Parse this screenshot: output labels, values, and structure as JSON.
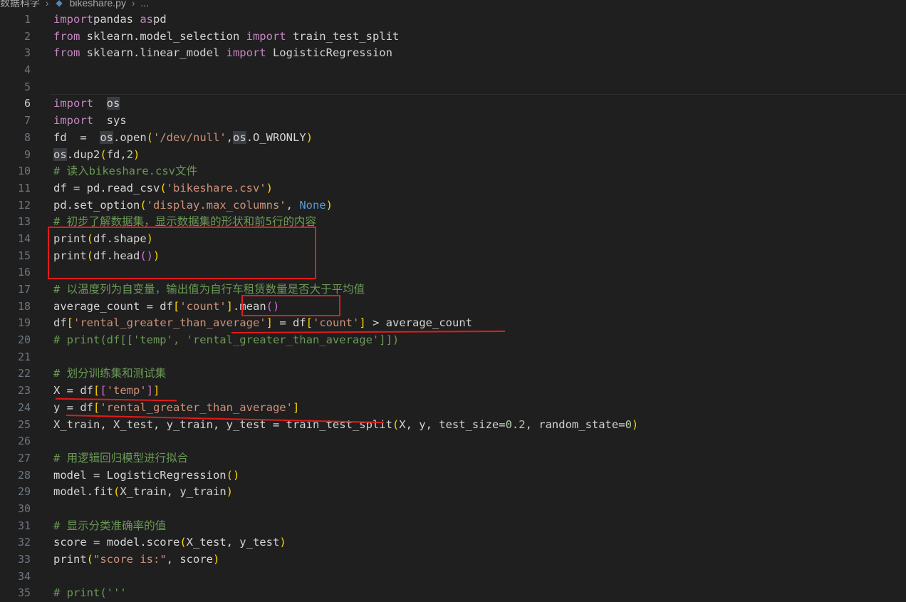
{
  "breadcrumb": {
    "folder": "数据科学",
    "file": "bikeshare.py",
    "more": "..."
  },
  "editor": {
    "active_line": 6,
    "lines": [
      {
        "n": "1",
        "tokens": [
          [
            "kw2",
            "import"
          ],
          [
            "",
            "pandas"
          ],
          [
            "kw2",
            " as"
          ],
          [
            "",
            "pd"
          ]
        ]
      },
      {
        "n": "2",
        "tokens": [
          [
            "kw2",
            "from"
          ],
          [
            "",
            " sklearn.model_selection "
          ],
          [
            "kw2",
            "import"
          ],
          [
            "",
            " train_test_split"
          ]
        ]
      },
      {
        "n": "3",
        "tokens": [
          [
            "kw2",
            "from"
          ],
          [
            "",
            " sklearn.linear_model "
          ],
          [
            "kw2",
            "import"
          ],
          [
            "",
            " LogisticRegression"
          ]
        ]
      },
      {
        "n": "4",
        "tokens": []
      },
      {
        "n": "5",
        "tokens": []
      },
      {
        "n": "6",
        "tokens": [
          [
            "kw2",
            "import"
          ],
          [
            "",
            "  "
          ],
          [
            "hl",
            "os"
          ]
        ]
      },
      {
        "n": "7",
        "tokens": [
          [
            "kw2",
            "import"
          ],
          [
            "",
            "  sys"
          ]
        ]
      },
      {
        "n": "8",
        "tokens": [
          [
            "",
            "fd  =  "
          ],
          [
            "hl",
            "os"
          ],
          [
            "",
            ".open"
          ],
          [
            "br1",
            "("
          ],
          [
            "str",
            "'/dev/null'"
          ],
          [
            "",
            ","
          ],
          [
            "hl",
            "os"
          ],
          [
            "",
            ".O_WRONLY"
          ],
          [
            "br1",
            ")"
          ]
        ]
      },
      {
        "n": "9",
        "tokens": [
          [
            "hl",
            "os"
          ],
          [
            "",
            ".dup2"
          ],
          [
            "br1",
            "("
          ],
          [
            "",
            "fd,"
          ],
          [
            "num",
            "2"
          ],
          [
            "br1",
            ")"
          ]
        ]
      },
      {
        "n": "10",
        "tokens": [
          [
            "cmt",
            "# 读入bikeshare.csv文件"
          ]
        ]
      },
      {
        "n": "11",
        "tokens": [
          [
            "",
            "df = pd.read_csv"
          ],
          [
            "br1",
            "("
          ],
          [
            "str",
            "'bikeshare.csv'"
          ],
          [
            "br1",
            ")"
          ]
        ]
      },
      {
        "n": "12",
        "tokens": [
          [
            "",
            "pd.set_option"
          ],
          [
            "br1",
            "("
          ],
          [
            "str",
            "'display.max_columns'"
          ],
          [
            "",
            ", "
          ],
          [
            "kw",
            "None"
          ],
          [
            "br1",
            ")"
          ]
        ]
      },
      {
        "n": "13",
        "tokens": [
          [
            "cmt",
            "# 初步了解数据集，显示数据集的形状和前5行的内容"
          ]
        ]
      },
      {
        "n": "14",
        "tokens": [
          [
            "",
            "print"
          ],
          [
            "br1",
            "("
          ],
          [
            "",
            "df.shape"
          ],
          [
            "br1",
            ")"
          ]
        ]
      },
      {
        "n": "15",
        "tokens": [
          [
            "",
            "print"
          ],
          [
            "br1",
            "("
          ],
          [
            "",
            "df.head"
          ],
          [
            "br2",
            "()"
          ],
          [
            "br1",
            ")"
          ]
        ]
      },
      {
        "n": "16",
        "tokens": []
      },
      {
        "n": "17",
        "tokens": [
          [
            "cmt",
            "# 以温度列为自变量，输出值为自行车租赁数量是否大于平均值"
          ]
        ]
      },
      {
        "n": "18",
        "tokens": [
          [
            "",
            "average_count = df"
          ],
          [
            "br1",
            "["
          ],
          [
            "str",
            "'count'"
          ],
          [
            "br1",
            "]"
          ],
          [
            "",
            "."
          ],
          [
            "",
            "mean"
          ],
          [
            "br2",
            "()"
          ]
        ]
      },
      {
        "n": "19",
        "tokens": [
          [
            "",
            "df"
          ],
          [
            "br1",
            "["
          ],
          [
            "str",
            "'rental_greater_than_average'"
          ],
          [
            "br1",
            "]"
          ],
          [
            "",
            " = df"
          ],
          [
            "br1",
            "["
          ],
          [
            "str",
            "'count'"
          ],
          [
            "br1",
            "]"
          ],
          [
            "",
            " > average_count"
          ]
        ]
      },
      {
        "n": "20",
        "tokens": [
          [
            "cmt",
            "# print(df[['temp', 'rental_greater_than_average']])"
          ]
        ]
      },
      {
        "n": "21",
        "tokens": []
      },
      {
        "n": "22",
        "tokens": [
          [
            "cmt",
            "# 划分训练集和测试集"
          ]
        ]
      },
      {
        "n": "23",
        "tokens": [
          [
            "",
            "X = df"
          ],
          [
            "br1",
            "["
          ],
          [
            "br2",
            "["
          ],
          [
            "str",
            "'temp'"
          ],
          [
            "br2",
            "]"
          ],
          [
            "br1",
            "]"
          ]
        ]
      },
      {
        "n": "24",
        "tokens": [
          [
            "",
            "y = df"
          ],
          [
            "br1",
            "["
          ],
          [
            "str",
            "'rental_greater_than_average'"
          ],
          [
            "br1",
            "]"
          ]
        ]
      },
      {
        "n": "25",
        "tokens": [
          [
            "",
            "X_train, X_test, y_train, y_test = train_test_split"
          ],
          [
            "br1",
            "("
          ],
          [
            "",
            "X, y, test_size="
          ],
          [
            "num",
            "0.2"
          ],
          [
            "",
            ", random_state="
          ],
          [
            "num",
            "0"
          ],
          [
            "br1",
            ")"
          ]
        ]
      },
      {
        "n": "26",
        "tokens": []
      },
      {
        "n": "27",
        "tokens": [
          [
            "cmt",
            "# 用逻辑回归模型进行拟合"
          ]
        ]
      },
      {
        "n": "28",
        "tokens": [
          [
            "",
            "model = LogisticRegression"
          ],
          [
            "br1",
            "()"
          ]
        ]
      },
      {
        "n": "29",
        "tokens": [
          [
            "",
            "model.fit"
          ],
          [
            "br1",
            "("
          ],
          [
            "",
            "X_train, y_train"
          ],
          [
            "br1",
            ")"
          ]
        ]
      },
      {
        "n": "30",
        "tokens": []
      },
      {
        "n": "31",
        "tokens": [
          [
            "cmt",
            "# 显示分类准确率的值"
          ]
        ]
      },
      {
        "n": "32",
        "tokens": [
          [
            "",
            "score = model.score"
          ],
          [
            "br1",
            "("
          ],
          [
            "",
            "X_test, y_test"
          ],
          [
            "br1",
            ")"
          ]
        ]
      },
      {
        "n": "33",
        "tokens": [
          [
            "",
            "print"
          ],
          [
            "br1",
            "("
          ],
          [
            "str",
            "\"score is:\""
          ],
          [
            "",
            ", score"
          ],
          [
            "br1",
            ")"
          ]
        ]
      },
      {
        "n": "34",
        "tokens": []
      },
      {
        "n": "35",
        "tokens": [
          [
            "cmt",
            "# print('''"
          ]
        ]
      }
    ]
  },
  "colors": {
    "background": "#1f1f1f",
    "annotation": "#e31b1b"
  }
}
